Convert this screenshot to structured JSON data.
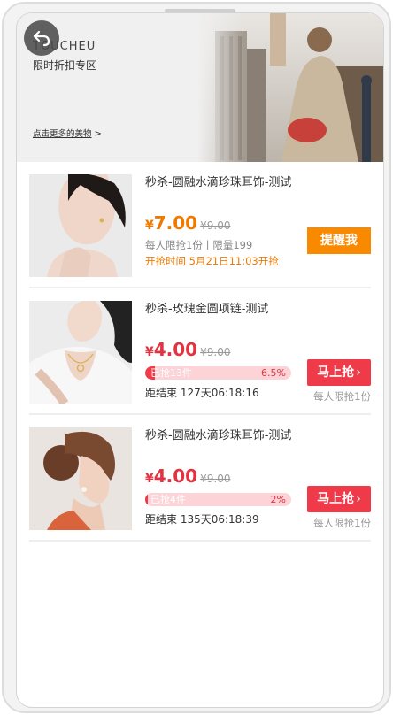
{
  "banner": {
    "brand": "TOUCHEU",
    "subtitle": "限时折扣专区",
    "more_link": "点击更多的美物",
    "more_chevron": ">"
  },
  "icons": {
    "back": "back-arrow-icon",
    "chevron": "chevron-right-icon"
  },
  "colors": {
    "accent_orange": "#f98a00",
    "accent_red": "#ef3b49",
    "progress_bg": "#fcd3d7"
  },
  "products": [
    {
      "title": "秒杀-圆融水滴珍珠耳饰-测试",
      "currency": "¥",
      "price": "7.00",
      "original_price": "¥9.00",
      "limit_info": "每人限抢1份丨限量199",
      "start_time": "开抢时间  5月21日11:03开抢",
      "button": "提醒我"
    },
    {
      "title": "秒杀-玫瑰金圆项链-测试",
      "currency": "¥",
      "price": "4.00",
      "original_price": "¥9.00",
      "sold_label": "已抢13件",
      "sold_percent": "6.5%",
      "progress": 0.065,
      "countdown": "距结束 127天06:18:16",
      "button": "马上抢",
      "limit_small": "每人限抢1份"
    },
    {
      "title": "秒杀-圆融水滴珍珠耳饰-测试",
      "currency": "¥",
      "price": "4.00",
      "original_price": "¥9.00",
      "sold_label": "已抢4件",
      "sold_percent": "2%",
      "progress": 0.02,
      "countdown": "距结束 135天06:18:39",
      "button": "马上抢",
      "limit_small": "每人限抢1份"
    }
  ]
}
